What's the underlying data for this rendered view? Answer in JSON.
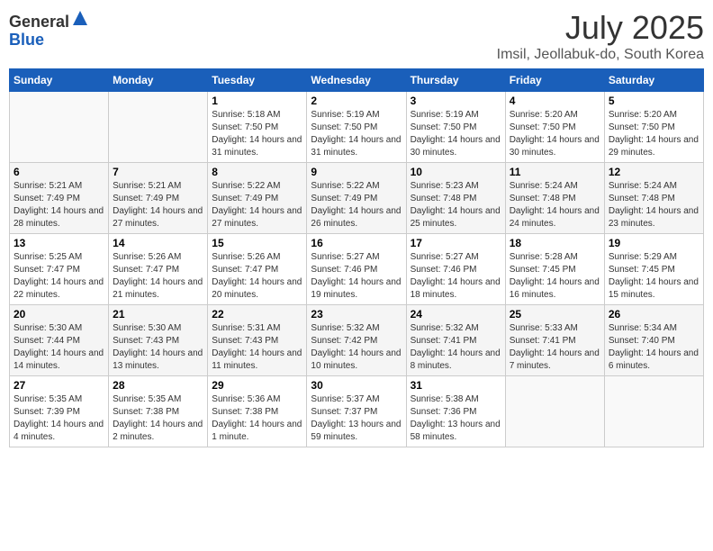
{
  "header": {
    "logo_general": "General",
    "logo_blue": "Blue",
    "month": "July 2025",
    "location": "Imsil, Jeollabuk-do, South Korea"
  },
  "weekdays": [
    "Sunday",
    "Monday",
    "Tuesday",
    "Wednesday",
    "Thursday",
    "Friday",
    "Saturday"
  ],
  "weeks": [
    [
      {
        "day": "",
        "sunrise": "",
        "sunset": "",
        "daylight": ""
      },
      {
        "day": "",
        "sunrise": "",
        "sunset": "",
        "daylight": ""
      },
      {
        "day": "1",
        "sunrise": "Sunrise: 5:18 AM",
        "sunset": "Sunset: 7:50 PM",
        "daylight": "Daylight: 14 hours and 31 minutes."
      },
      {
        "day": "2",
        "sunrise": "Sunrise: 5:19 AM",
        "sunset": "Sunset: 7:50 PM",
        "daylight": "Daylight: 14 hours and 31 minutes."
      },
      {
        "day": "3",
        "sunrise": "Sunrise: 5:19 AM",
        "sunset": "Sunset: 7:50 PM",
        "daylight": "Daylight: 14 hours and 30 minutes."
      },
      {
        "day": "4",
        "sunrise": "Sunrise: 5:20 AM",
        "sunset": "Sunset: 7:50 PM",
        "daylight": "Daylight: 14 hours and 30 minutes."
      },
      {
        "day": "5",
        "sunrise": "Sunrise: 5:20 AM",
        "sunset": "Sunset: 7:50 PM",
        "daylight": "Daylight: 14 hours and 29 minutes."
      }
    ],
    [
      {
        "day": "6",
        "sunrise": "Sunrise: 5:21 AM",
        "sunset": "Sunset: 7:49 PM",
        "daylight": "Daylight: 14 hours and 28 minutes."
      },
      {
        "day": "7",
        "sunrise": "Sunrise: 5:21 AM",
        "sunset": "Sunset: 7:49 PM",
        "daylight": "Daylight: 14 hours and 27 minutes."
      },
      {
        "day": "8",
        "sunrise": "Sunrise: 5:22 AM",
        "sunset": "Sunset: 7:49 PM",
        "daylight": "Daylight: 14 hours and 27 minutes."
      },
      {
        "day": "9",
        "sunrise": "Sunrise: 5:22 AM",
        "sunset": "Sunset: 7:49 PM",
        "daylight": "Daylight: 14 hours and 26 minutes."
      },
      {
        "day": "10",
        "sunrise": "Sunrise: 5:23 AM",
        "sunset": "Sunset: 7:48 PM",
        "daylight": "Daylight: 14 hours and 25 minutes."
      },
      {
        "day": "11",
        "sunrise": "Sunrise: 5:24 AM",
        "sunset": "Sunset: 7:48 PM",
        "daylight": "Daylight: 14 hours and 24 minutes."
      },
      {
        "day": "12",
        "sunrise": "Sunrise: 5:24 AM",
        "sunset": "Sunset: 7:48 PM",
        "daylight": "Daylight: 14 hours and 23 minutes."
      }
    ],
    [
      {
        "day": "13",
        "sunrise": "Sunrise: 5:25 AM",
        "sunset": "Sunset: 7:47 PM",
        "daylight": "Daylight: 14 hours and 22 minutes."
      },
      {
        "day": "14",
        "sunrise": "Sunrise: 5:26 AM",
        "sunset": "Sunset: 7:47 PM",
        "daylight": "Daylight: 14 hours and 21 minutes."
      },
      {
        "day": "15",
        "sunrise": "Sunrise: 5:26 AM",
        "sunset": "Sunset: 7:47 PM",
        "daylight": "Daylight: 14 hours and 20 minutes."
      },
      {
        "day": "16",
        "sunrise": "Sunrise: 5:27 AM",
        "sunset": "Sunset: 7:46 PM",
        "daylight": "Daylight: 14 hours and 19 minutes."
      },
      {
        "day": "17",
        "sunrise": "Sunrise: 5:27 AM",
        "sunset": "Sunset: 7:46 PM",
        "daylight": "Daylight: 14 hours and 18 minutes."
      },
      {
        "day": "18",
        "sunrise": "Sunrise: 5:28 AM",
        "sunset": "Sunset: 7:45 PM",
        "daylight": "Daylight: 14 hours and 16 minutes."
      },
      {
        "day": "19",
        "sunrise": "Sunrise: 5:29 AM",
        "sunset": "Sunset: 7:45 PM",
        "daylight": "Daylight: 14 hours and 15 minutes."
      }
    ],
    [
      {
        "day": "20",
        "sunrise": "Sunrise: 5:30 AM",
        "sunset": "Sunset: 7:44 PM",
        "daylight": "Daylight: 14 hours and 14 minutes."
      },
      {
        "day": "21",
        "sunrise": "Sunrise: 5:30 AM",
        "sunset": "Sunset: 7:43 PM",
        "daylight": "Daylight: 14 hours and 13 minutes."
      },
      {
        "day": "22",
        "sunrise": "Sunrise: 5:31 AM",
        "sunset": "Sunset: 7:43 PM",
        "daylight": "Daylight: 14 hours and 11 minutes."
      },
      {
        "day": "23",
        "sunrise": "Sunrise: 5:32 AM",
        "sunset": "Sunset: 7:42 PM",
        "daylight": "Daylight: 14 hours and 10 minutes."
      },
      {
        "day": "24",
        "sunrise": "Sunrise: 5:32 AM",
        "sunset": "Sunset: 7:41 PM",
        "daylight": "Daylight: 14 hours and 8 minutes."
      },
      {
        "day": "25",
        "sunrise": "Sunrise: 5:33 AM",
        "sunset": "Sunset: 7:41 PM",
        "daylight": "Daylight: 14 hours and 7 minutes."
      },
      {
        "day": "26",
        "sunrise": "Sunrise: 5:34 AM",
        "sunset": "Sunset: 7:40 PM",
        "daylight": "Daylight: 14 hours and 6 minutes."
      }
    ],
    [
      {
        "day": "27",
        "sunrise": "Sunrise: 5:35 AM",
        "sunset": "Sunset: 7:39 PM",
        "daylight": "Daylight: 14 hours and 4 minutes."
      },
      {
        "day": "28",
        "sunrise": "Sunrise: 5:35 AM",
        "sunset": "Sunset: 7:38 PM",
        "daylight": "Daylight: 14 hours and 2 minutes."
      },
      {
        "day": "29",
        "sunrise": "Sunrise: 5:36 AM",
        "sunset": "Sunset: 7:38 PM",
        "daylight": "Daylight: 14 hours and 1 minute."
      },
      {
        "day": "30",
        "sunrise": "Sunrise: 5:37 AM",
        "sunset": "Sunset: 7:37 PM",
        "daylight": "Daylight: 13 hours and 59 minutes."
      },
      {
        "day": "31",
        "sunrise": "Sunrise: 5:38 AM",
        "sunset": "Sunset: 7:36 PM",
        "daylight": "Daylight: 13 hours and 58 minutes."
      },
      {
        "day": "",
        "sunrise": "",
        "sunset": "",
        "daylight": ""
      },
      {
        "day": "",
        "sunrise": "",
        "sunset": "",
        "daylight": ""
      }
    ]
  ]
}
